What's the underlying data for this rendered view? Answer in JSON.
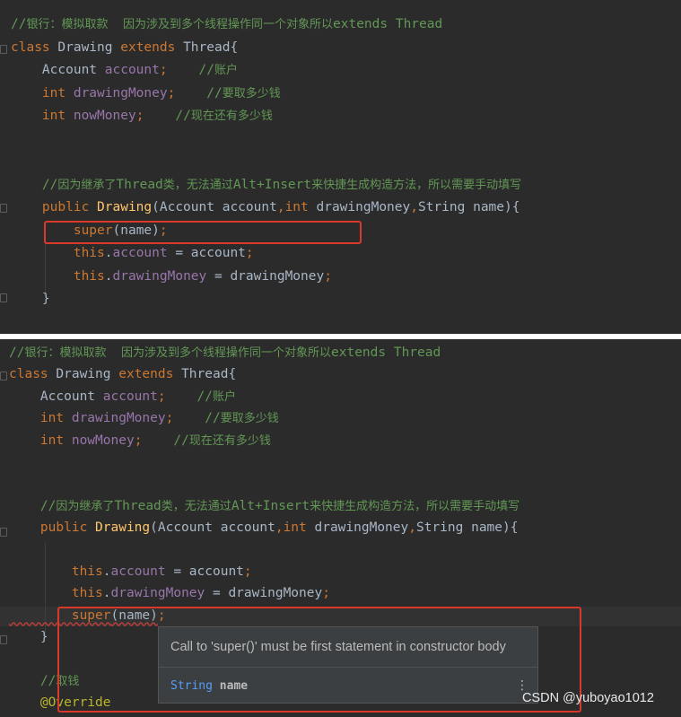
{
  "snippet_before": {
    "lines": [
      [
        [
          "c-comment",
          "//"
        ],
        [
          "c-comment cjk",
          "银行：模拟取款    因为涉及到多个线程操作同一个对象所以"
        ],
        [
          "c-comment",
          "extends Thread"
        ]
      ],
      [
        [
          "c-kw",
          "class "
        ],
        [
          "c-plain",
          "Drawing "
        ],
        [
          "c-kw",
          "extends "
        ],
        [
          "c-plain",
          "Thread{"
        ]
      ],
      [
        [
          "c-plain",
          "    Account "
        ],
        [
          "c-field",
          "account"
        ],
        [
          "c-kw",
          ";"
        ],
        [
          "c-plain",
          "    "
        ],
        [
          "c-comment",
          "//"
        ],
        [
          "c-comment cjk",
          "账户"
        ]
      ],
      [
        [
          "c-kw",
          "    int "
        ],
        [
          "c-field",
          "drawingMoney"
        ],
        [
          "c-kw",
          ";"
        ],
        [
          "c-plain",
          "    "
        ],
        [
          "c-comment",
          "//"
        ],
        [
          "c-comment cjk",
          "要取多少钱"
        ]
      ],
      [
        [
          "c-kw",
          "    int "
        ],
        [
          "c-field",
          "nowMoney"
        ],
        [
          "c-kw",
          ";"
        ],
        [
          "c-plain",
          "    "
        ],
        [
          "c-comment",
          "//"
        ],
        [
          "c-comment cjk",
          "现在还有多少钱"
        ]
      ],
      [],
      [],
      [
        [
          "c-comment",
          "    //"
        ],
        [
          "c-comment cjk",
          "因为继承了"
        ],
        [
          "c-comment",
          "Thread"
        ],
        [
          "c-comment cjk",
          "类，无法通过"
        ],
        [
          "c-comment",
          "Alt+Insert"
        ],
        [
          "c-comment cjk",
          "来快捷生成构造方法，所以需要手动填写"
        ]
      ],
      [
        [
          "c-kw",
          "    public "
        ],
        [
          "c-fn",
          "Drawing"
        ],
        [
          "c-plain",
          "(Account account"
        ],
        [
          "c-kw",
          ","
        ],
        [
          "c-kw",
          "int "
        ],
        [
          "c-plain",
          "drawingMoney"
        ],
        [
          "c-kw",
          ","
        ],
        [
          "c-plain",
          "String name){"
        ]
      ],
      [
        [
          "c-kw",
          "        super"
        ],
        [
          "c-plain",
          "(name)"
        ],
        [
          "c-kw",
          ";"
        ]
      ],
      [
        [
          "c-kw",
          "        this"
        ],
        [
          "c-plain",
          "."
        ],
        [
          "c-field",
          "account"
        ],
        [
          "c-plain",
          " = account"
        ],
        [
          "c-kw",
          ";"
        ]
      ],
      [
        [
          "c-kw",
          "        this"
        ],
        [
          "c-plain",
          "."
        ],
        [
          "c-field",
          "drawingMoney"
        ],
        [
          "c-plain",
          " = drawingMoney"
        ],
        [
          "c-kw",
          ";"
        ]
      ],
      [
        [
          "c-plain",
          "    }"
        ]
      ]
    ]
  },
  "snippet_after": {
    "lines": [
      [
        [
          "c-comment",
          "//"
        ],
        [
          "c-comment cjk",
          "银行：模拟取款    因为涉及到多个线程操作同一个对象所以"
        ],
        [
          "c-comment",
          "extends Thread"
        ]
      ],
      [
        [
          "c-kw",
          "class "
        ],
        [
          "c-plain",
          "Drawing "
        ],
        [
          "c-kw",
          "extends "
        ],
        [
          "c-plain",
          "Thread{"
        ]
      ],
      [
        [
          "c-plain",
          "    Account "
        ],
        [
          "c-field",
          "account"
        ],
        [
          "c-kw",
          ";"
        ],
        [
          "c-plain",
          "    "
        ],
        [
          "c-comment",
          "//"
        ],
        [
          "c-comment cjk",
          "账户"
        ]
      ],
      [
        [
          "c-kw",
          "    int "
        ],
        [
          "c-field",
          "drawingMoney"
        ],
        [
          "c-kw",
          ";"
        ],
        [
          "c-plain",
          "    "
        ],
        [
          "c-comment",
          "//"
        ],
        [
          "c-comment cjk",
          "要取多少钱"
        ]
      ],
      [
        [
          "c-kw",
          "    int "
        ],
        [
          "c-field",
          "nowMoney"
        ],
        [
          "c-kw",
          ";"
        ],
        [
          "c-plain",
          "    "
        ],
        [
          "c-comment",
          "//"
        ],
        [
          "c-comment cjk",
          "现在还有多少钱"
        ]
      ],
      [],
      [],
      [
        [
          "c-comment",
          "    //"
        ],
        [
          "c-comment cjk",
          "因为继承了"
        ],
        [
          "c-comment",
          "Thread"
        ],
        [
          "c-comment cjk",
          "类，无法通过"
        ],
        [
          "c-comment",
          "Alt+Insert"
        ],
        [
          "c-comment cjk",
          "来快捷生成构造方法，所以需要手动填写"
        ]
      ],
      [
        [
          "c-kw",
          "    public "
        ],
        [
          "c-fn",
          "Drawing"
        ],
        [
          "c-plain",
          "(Account account"
        ],
        [
          "c-kw",
          ","
        ],
        [
          "c-kw",
          "int "
        ],
        [
          "c-plain",
          "drawingMoney"
        ],
        [
          "c-kw",
          ","
        ],
        [
          "c-plain",
          "String name){"
        ]
      ],
      [],
      [
        [
          "c-kw",
          "        this"
        ],
        [
          "c-plain",
          "."
        ],
        [
          "c-field",
          "account"
        ],
        [
          "c-plain",
          " = account"
        ],
        [
          "c-kw",
          ";"
        ]
      ],
      [
        [
          "c-kw",
          "        this"
        ],
        [
          "c-plain",
          "."
        ],
        [
          "c-field",
          "drawingMoney"
        ],
        [
          "c-plain",
          " = drawingMoney"
        ],
        [
          "c-kw",
          ";"
        ]
      ],
      [
        [
          "c-kw squiggle",
          "        super"
        ],
        [
          "c-plain squiggle",
          "(name)"
        ],
        [
          "c-kw",
          ";"
        ]
      ],
      [
        [
          "c-plain",
          "    }"
        ]
      ],
      [],
      [
        [
          "c-comment",
          "    //"
        ],
        [
          "c-comment cjk",
          "取钱"
        ]
      ],
      [
        [
          "c-ann",
          "    @Override"
        ]
      ]
    ]
  },
  "tooltip": {
    "message": "Call to 'super()' must be first statement in constructor body",
    "param_type": "String",
    "param_name": "name",
    "more_icon": "more-vertical-icon"
  },
  "watermark": "CSDN @yuboyao1012",
  "colors": {
    "editor_bg": "#2b2b2b",
    "keyword": "#cc7832",
    "comment": "#629755",
    "field": "#9876aa",
    "function": "#ffc66d",
    "text": "#a9b7c6",
    "highlight_box": "#d9392b",
    "error_squiggle": "#bc3f3c"
  }
}
